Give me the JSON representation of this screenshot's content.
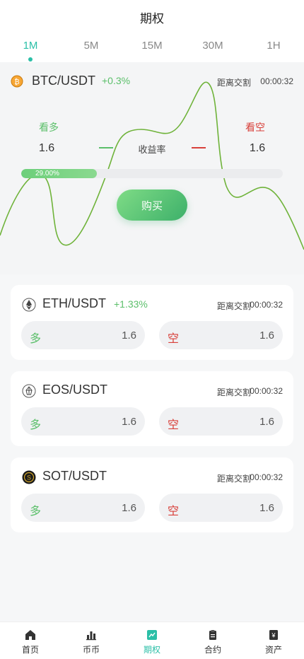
{
  "page": {
    "title": "期权"
  },
  "tabs": [
    {
      "label": "1M",
      "active": true
    },
    {
      "label": "5M"
    },
    {
      "label": "15M"
    },
    {
      "label": "30M"
    },
    {
      "label": "1H"
    }
  ],
  "hero": {
    "pair": "BTC/USDT",
    "change": "+0.3%",
    "countdown_label": "距离交割",
    "countdown": "00:00:32",
    "long_label": "看多",
    "short_label": "看空",
    "long_value": "1.6",
    "short_value": "1.6",
    "rate_label": "收益率",
    "progress_text": "29.00%",
    "progress_fraction": 0.29,
    "buy_label": "购买",
    "coin_icon": "bitcoin-icon"
  },
  "markets": [
    {
      "pair": "ETH/USDT",
      "change": "+1.33%",
      "countdown_label": "距离交割",
      "countdown": "00:00:32",
      "long_label": "多",
      "long_value": "1.6",
      "short_label": "空",
      "short_value": "1.6",
      "icon": "ethereum-icon"
    },
    {
      "pair": "EOS/USDT",
      "change": "",
      "countdown_label": "距离交割",
      "countdown": "00:00:32",
      "long_label": "多",
      "long_value": "1.6",
      "short_label": "空",
      "short_value": "1.6",
      "icon": "eos-icon"
    },
    {
      "pair": "SOT/USDT",
      "change": "",
      "countdown_label": "距离交割",
      "countdown": "00:00:32",
      "long_label": "多",
      "long_value": "1.6",
      "short_label": "空",
      "short_value": "1.6",
      "icon": "sot-coin-icon"
    }
  ],
  "tabbar": [
    {
      "label": "首页",
      "icon": "home-icon"
    },
    {
      "label": "币币",
      "icon": "bar-chart-icon"
    },
    {
      "label": "期权",
      "icon": "options-chart-icon",
      "active": true
    },
    {
      "label": "合约",
      "icon": "clipboard-icon"
    },
    {
      "label": "资产",
      "icon": "wallet-icon"
    }
  ],
  "colors": {
    "accent": "#2bbfa7",
    "long": "#5bbf6a",
    "short": "#d8403a",
    "wave": "#6fb33a"
  }
}
